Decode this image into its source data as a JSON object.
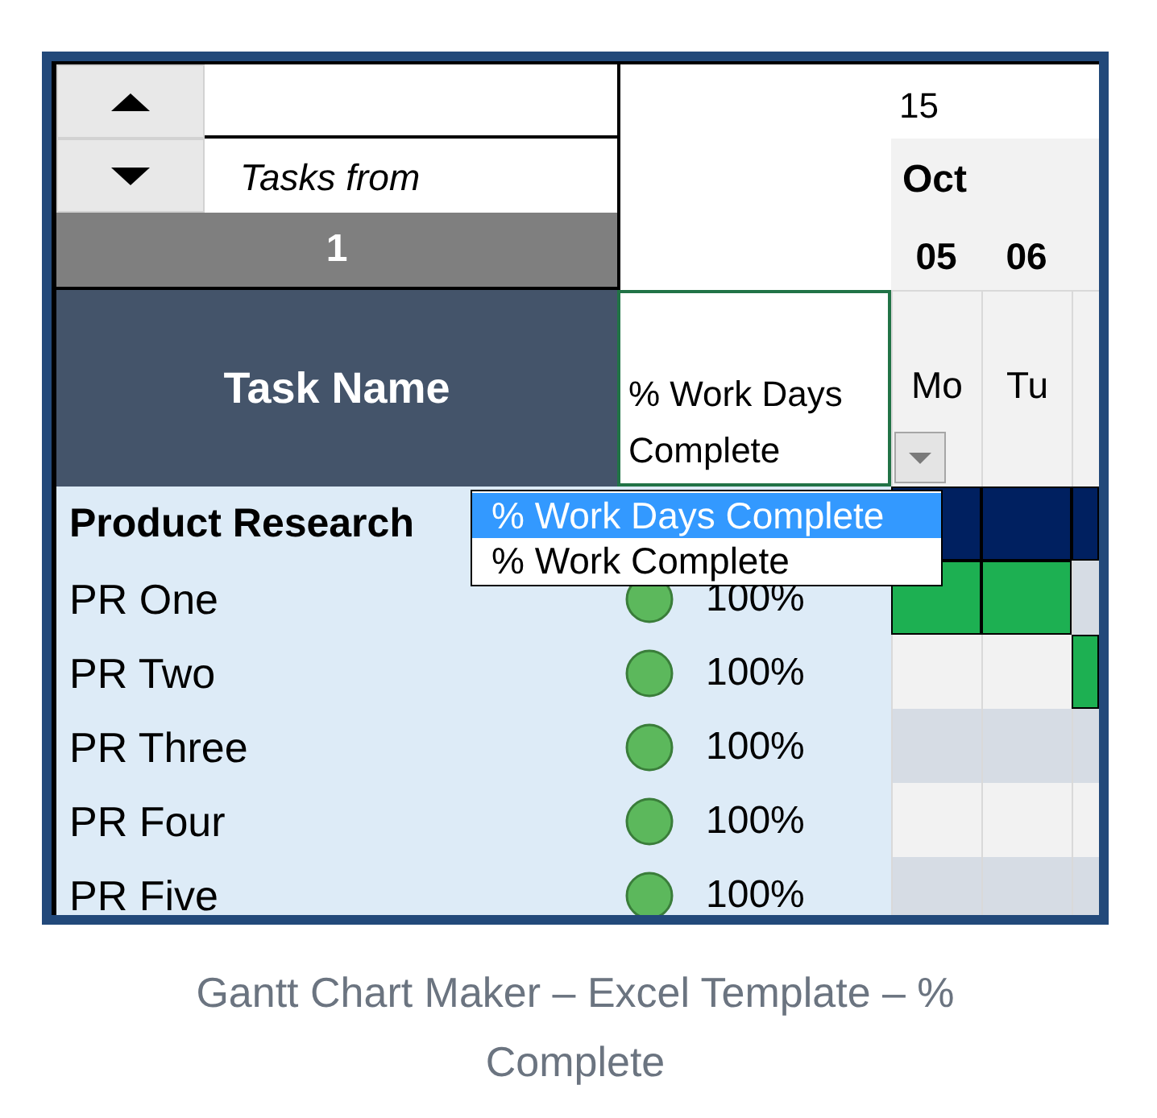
{
  "scroll_buttons": [
    {
      "kind": "up"
    },
    {
      "kind": "down"
    }
  ],
  "tasks_from": {
    "label": "Tasks from",
    "value": "1"
  },
  "timeline_header": {
    "number": "15",
    "month": "Oct",
    "dates": [
      "05",
      "06"
    ],
    "weekdays": [
      "Mo",
      "Tu"
    ]
  },
  "columns": {
    "task_name": "Task Name",
    "progress": "% Work Days Complete"
  },
  "progress_dropdown": {
    "options": [
      {
        "label": "% Work Days Complete",
        "selected": true
      },
      {
        "label": "% Work Complete",
        "selected": false
      }
    ]
  },
  "rows": [
    {
      "kind": "summary",
      "name": "Product Research",
      "bars": [
        true,
        true,
        true
      ]
    },
    {
      "kind": "task",
      "name": "PR One",
      "color": "#5cb85c",
      "progress": "100%",
      "bars": [
        true,
        true,
        false
      ]
    },
    {
      "kind": "task",
      "name": "PR Two",
      "color": "#5cb85c",
      "progress": "100%",
      "bars": [
        false,
        false,
        true
      ]
    },
    {
      "kind": "task",
      "name": "PR Three",
      "color": "#5cb85c",
      "progress": "100%",
      "bars": [
        false,
        false,
        false
      ]
    },
    {
      "kind": "task",
      "name": "PR Four",
      "color": "#5cb85c",
      "progress": "100%",
      "bars": [
        false,
        false,
        false
      ]
    },
    {
      "kind": "task",
      "name": "PR Five",
      "color": "#5cb85c",
      "progress": "100%",
      "bars": [
        false,
        false,
        false
      ]
    }
  ],
  "caption": "Gantt Chart Maker – Excel Template – % Complete"
}
